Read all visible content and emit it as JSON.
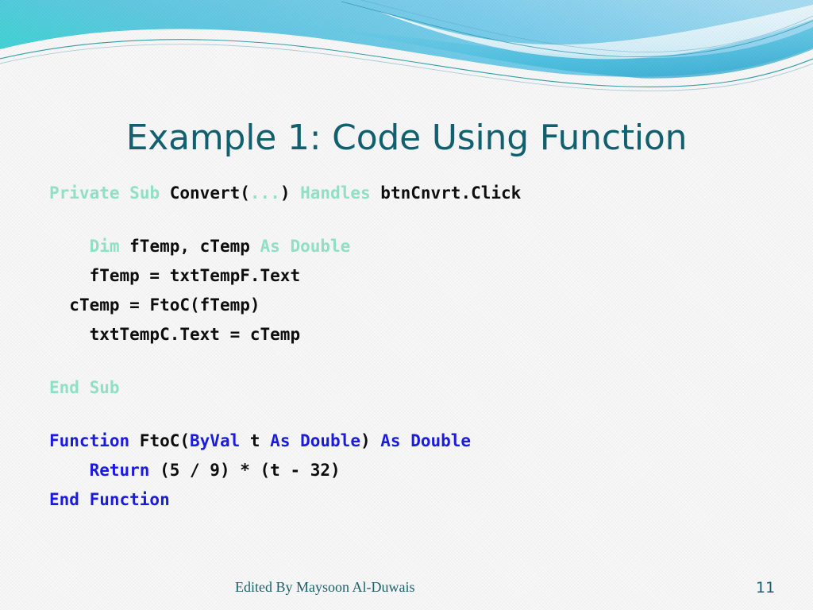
{
  "slide": {
    "title": "Example 1: Code Using Function",
    "background_color": "#f8f8f8",
    "title_color": "#12606f"
  },
  "theme": {
    "banner_gradient_start": "#4fd3d8",
    "banner_gradient_end": "#8fd4f0",
    "wave_accent": "#2fa8c8",
    "wave_line": "#10808f",
    "keyword_teal": "#8fe0c4",
    "keyword_blue": "#1a1ae0",
    "code_black": "#0d0d0d",
    "footer_color": "#1a5f6b"
  },
  "code": {
    "language": "Visual Basic .NET",
    "lines": [
      {
        "id": "line-sub-signature",
        "indent": 0,
        "tokens": [
          {
            "text": "Private",
            "style": "teal"
          },
          {
            "text": " ",
            "style": "black"
          },
          {
            "text": "Sub",
            "style": "teal"
          },
          {
            "text": " Convert(",
            "style": "black"
          },
          {
            "text": "...",
            "style": "teal"
          },
          {
            "text": ") ",
            "style": "black"
          },
          {
            "text": "Handles",
            "style": "teal"
          },
          {
            "text": " btnCnvrt.Click",
            "style": "black"
          }
        ]
      },
      {
        "id": "line-blank-1",
        "indent": 0,
        "blank": true,
        "tokens": []
      },
      {
        "id": "line-dim",
        "indent": 2,
        "tokens": [
          {
            "text": "Dim",
            "style": "teal"
          },
          {
            "text": " fTemp, cTemp ",
            "style": "black"
          },
          {
            "text": "As Double",
            "style": "teal"
          }
        ]
      },
      {
        "id": "line-ftemp-assign",
        "indent": 2,
        "tokens": [
          {
            "text": "fTemp = txtTempF.Text",
            "style": "black"
          }
        ]
      },
      {
        "id": "line-ctemp-assign",
        "indent": 1,
        "tokens": [
          {
            "text": "cTemp = FtoC(fTemp)",
            "style": "black"
          }
        ]
      },
      {
        "id": "line-txttempc-assign",
        "indent": 2,
        "tokens": [
          {
            "text": "txtTempC.Text = cTemp",
            "style": "black"
          }
        ]
      },
      {
        "id": "line-blank-2",
        "indent": 0,
        "blank": true,
        "tokens": []
      },
      {
        "id": "line-end-sub",
        "indent": 0,
        "tokens": [
          {
            "text": "End Sub",
            "style": "teal"
          }
        ]
      },
      {
        "id": "line-blank-3",
        "indent": 0,
        "blank": true,
        "tokens": []
      },
      {
        "id": "line-function-signature",
        "indent": 0,
        "tokens": [
          {
            "text": "Function",
            "style": "blue"
          },
          {
            "text": " FtoC(",
            "style": "black"
          },
          {
            "text": "ByVal",
            "style": "blue"
          },
          {
            "text": " t ",
            "style": "black"
          },
          {
            "text": "As Double",
            "style": "blue"
          },
          {
            "text": ") ",
            "style": "black"
          },
          {
            "text": "As Double",
            "style": "blue"
          }
        ]
      },
      {
        "id": "line-return",
        "indent": 2,
        "tokens": [
          {
            "text": "Return",
            "style": "blue"
          },
          {
            "text": " (5 / 9) * (t - 32)",
            "style": "black"
          }
        ]
      },
      {
        "id": "line-end-function",
        "indent": 0,
        "tokens": [
          {
            "text": "End Function",
            "style": "blue"
          }
        ]
      }
    ]
  },
  "footer": {
    "credit": "Edited By Maysoon Al-Duwais",
    "page_number": "11"
  }
}
